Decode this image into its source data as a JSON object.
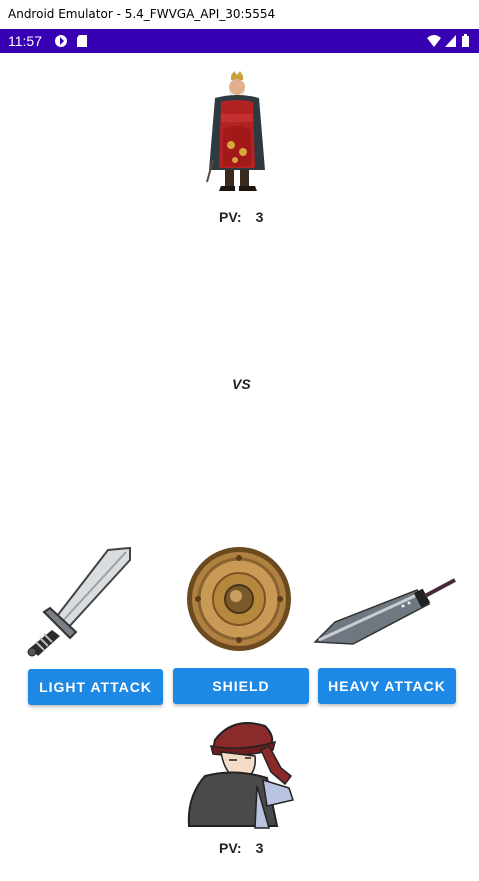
{
  "window": {
    "title": "Android Emulator - 5.4_FWVGA_API_30:5554"
  },
  "status_bar": {
    "time": "11:57",
    "background": "#3700b3"
  },
  "enemy": {
    "pv_label": "PV:",
    "pv_value": "3",
    "image": "king-character"
  },
  "vs_label": "VS",
  "weapons": [
    {
      "image": "sword-icon"
    },
    {
      "image": "round-shield-icon"
    },
    {
      "image": "greatsword-icon"
    }
  ],
  "actions": {
    "light_attack": "LIGHT ATTACK",
    "shield": "SHIELD",
    "heavy_attack": "HEAVY ATTACK",
    "button_color": "#1e88e5"
  },
  "player": {
    "pv_label": "PV:",
    "pv_value": "3",
    "image": "hooded-player-character"
  }
}
